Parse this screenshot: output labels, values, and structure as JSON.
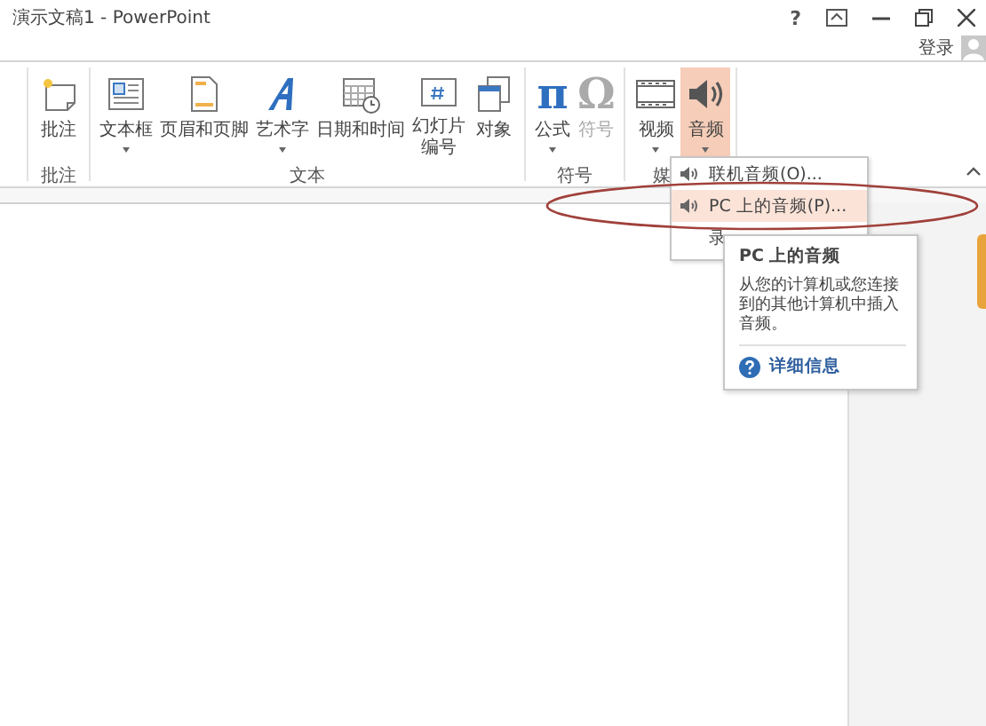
{
  "window": {
    "title": "演示文稿1 - PowerPoint",
    "controls": [
      "?"
    ]
  },
  "account": {
    "sign_in": "登录"
  },
  "ribbon": {
    "groups": [
      {
        "label": "批注",
        "buttons": [
          {
            "kind": "comment",
            "label": "批注",
            "dropdown": false,
            "disabled": false,
            "selected": false
          }
        ]
      },
      {
        "label": "文本",
        "buttons": [
          {
            "kind": "textbox",
            "label": "文本框",
            "dropdown": true,
            "disabled": false,
            "selected": false
          },
          {
            "kind": "header",
            "label": "页眉和页脚",
            "dropdown": false,
            "disabled": false,
            "selected": false
          },
          {
            "kind": "wordart",
            "label": "艺术字",
            "dropdown": true,
            "disabled": false,
            "selected": false
          },
          {
            "kind": "calendar",
            "label": "日期和时间",
            "dropdown": false,
            "disabled": false,
            "selected": false
          },
          {
            "kind": "slidenumber",
            "label": "幻灯片",
            "label2": "编号",
            "dropdown": false,
            "disabled": false,
            "selected": false
          },
          {
            "kind": "object",
            "label": "对象",
            "dropdown": false,
            "disabled": false,
            "selected": false
          }
        ]
      },
      {
        "label": "符号",
        "buttons": [
          {
            "kind": "glyph",
            "glyph": "π",
            "label": "公式",
            "dropdown": true,
            "disabled": false,
            "selected": false
          },
          {
            "kind": "glyph",
            "glyph": "Ω",
            "label": "符号",
            "dropdown": false,
            "disabled": true,
            "selected": false
          }
        ]
      },
      {
        "label": "媒",
        "buttons": [
          {
            "kind": "video",
            "label": "视频",
            "dropdown": true,
            "disabled": false,
            "selected": false
          },
          {
            "kind": "audio",
            "label": "音频",
            "dropdown": true,
            "disabled": false,
            "selected": true
          }
        ]
      }
    ]
  },
  "audio_menu": {
    "items": [
      {
        "label": "联机音频(O)...",
        "icon": true,
        "selected": false
      },
      {
        "label": "PC 上的音频(P)...",
        "icon": true,
        "selected": true
      },
      {
        "label": "录",
        "icon": false,
        "selected": false
      }
    ]
  },
  "tooltip": {
    "title": "PC 上的音频",
    "body": "从您的计算机或您连接到的其他计算机中插入音频。",
    "link": "详细信息"
  }
}
